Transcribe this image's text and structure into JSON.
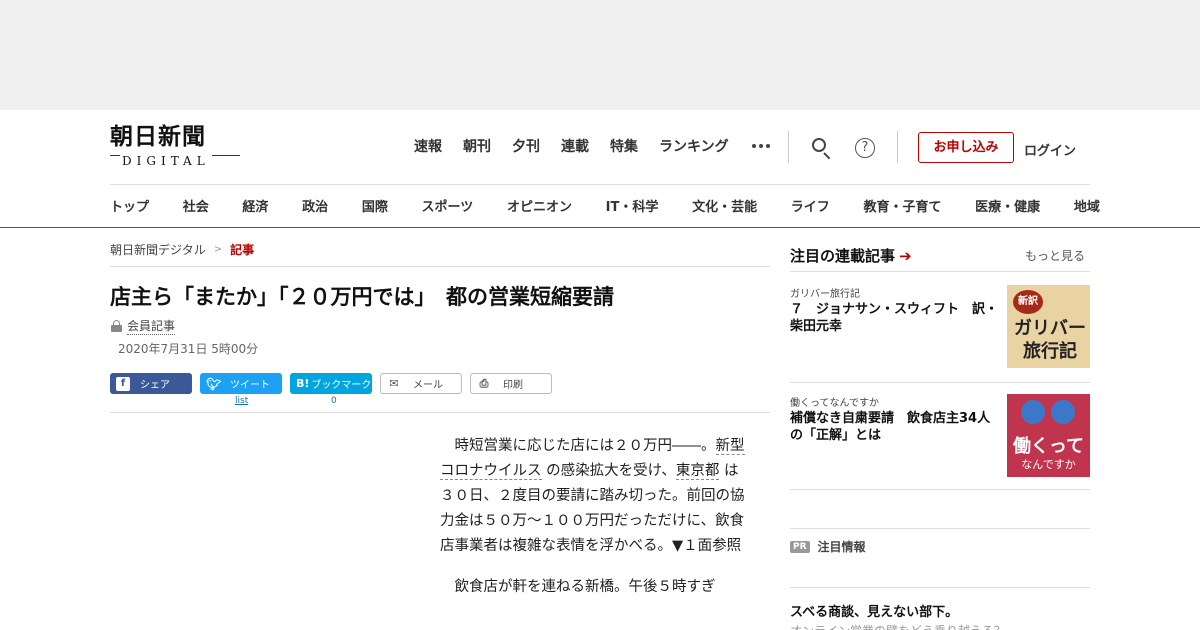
{
  "header": {
    "logo_kanji": "朝日新聞",
    "logo_sub": "DIGITAL",
    "topnav": [
      "速報",
      "朝刊",
      "夕刊",
      "連載",
      "特集",
      "ランキング"
    ],
    "help_glyph": "?",
    "signup": "お申し込み",
    "login": "ログイン"
  },
  "categories": [
    "トップ",
    "社会",
    "経済",
    "政治",
    "国際",
    "スポーツ",
    "オピニオン",
    "IT・科学",
    "文化・芸能",
    "ライフ",
    "教育・子育て",
    "医療・健康",
    "地域"
  ],
  "breadcrumb": {
    "root": "朝日新聞デジタル",
    "sep": ">",
    "current": "記事"
  },
  "article": {
    "headline": "店主ら「またか」「２０万円では」　都の営業短縮要請",
    "member_label": "会員記事",
    "date": "2020年7月31日 5時00分",
    "share": {
      "facebook": "シェア",
      "twitter": "ツイート",
      "hatena": "ブックマーク",
      "mail": "メール",
      "print": "印刷",
      "twitter_count": "list",
      "hatena_count": "0",
      "hatena_glyph": "B!"
    },
    "p1_a": "時短営業に応じた店には２０万円――。",
    "p1_kw1": "新型コロナウイルス",
    "p1_b": " の感染拡大を受け、",
    "p1_kw2": "東京都",
    "p1_c": " は３０日、２度目の要請に踏み切った。前回の協力金は５０万～１００万円だっただけに、飲食店事業者は複雑な表情を浮かべる。▼１面参照",
    "p2": "飲食店が軒を連ねる新橋。午後５時すぎ"
  },
  "sidebar": {
    "title": "注目の連載記事",
    "more": "もっと見る",
    "items": [
      {
        "series": "ガリバー旅行記",
        "title": "７　ジョナサン・スウィフト　訳・柴田元幸",
        "thumb_badge": "新訳",
        "thumb_text": "ガリバー旅行記"
      },
      {
        "series": "働くってなんですか",
        "title": "補償なき自粛要請　飲食店主34人の「正解」とは",
        "thumb_t1": "働くって",
        "thumb_t2": "なんですか"
      }
    ],
    "pr_badge": "PR",
    "pr_label": "注目情報",
    "pr_title": "スベる商談、見えない部下。",
    "pr_sub": "オンライン営業の壁をどう乗り越える？"
  },
  "colors": {
    "brand_red": "#b00000",
    "facebook": "#3b5998",
    "twitter": "#1da1f2",
    "hatena": "#00a4de"
  }
}
